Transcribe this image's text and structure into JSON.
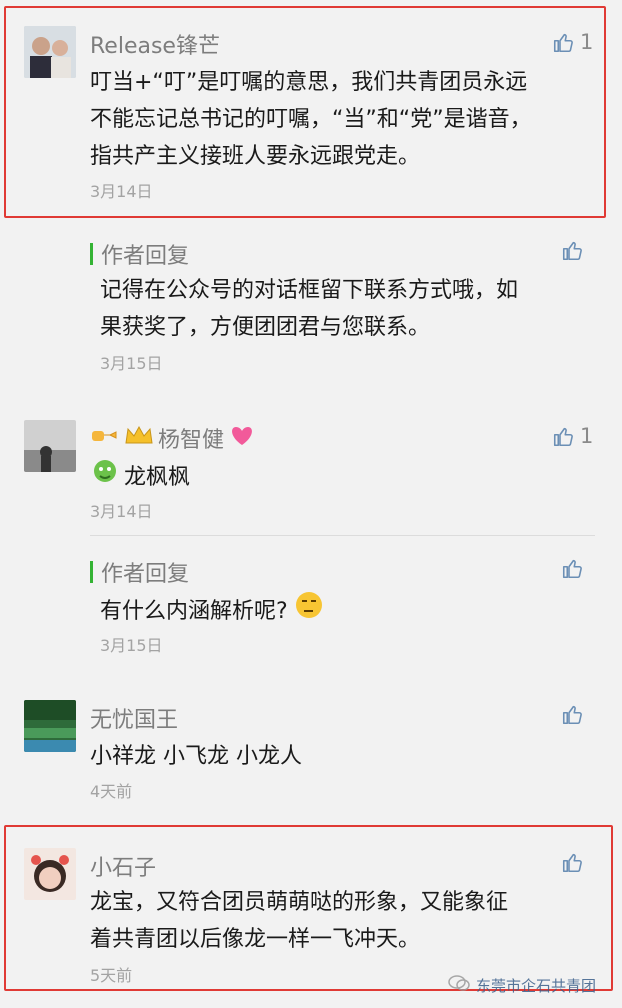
{
  "comments": [
    {
      "name": "Release锋芒",
      "likes": "1",
      "text_lines": [
        "叮当+“叮”是叮嘱的意思，我们共青团员永远",
        "不能忘记总书记的叮嘱，“当”和“党”是谐音，",
        "指共产主义接班人要永远跟党走。"
      ],
      "date": "3月14日",
      "reply": {
        "label": "作者回复",
        "text_lines": [
          "记得在公众号的对话框留下联系方式哦，如",
          "果获奖了，方便团团君与您联系。"
        ],
        "date": "3月15日"
      }
    },
    {
      "name": "杨智健",
      "likes": "1",
      "text": "龙枫枫",
      "date": "3月14日",
      "reply": {
        "label": "作者回复",
        "text": "有什么内涵解析呢?",
        "date": "3月15日"
      }
    },
    {
      "name": "无忧国王",
      "text": "小祥龙 小飞龙 小龙人",
      "date": "4天前"
    },
    {
      "name": "小石子",
      "text_lines": [
        "龙宝，又符合团员萌萌哒的形象，又能象征",
        "着共青团以后像龙一样一飞冲天。"
      ],
      "date": "5天前"
    }
  ],
  "watermark": "东莞市企石共青团"
}
